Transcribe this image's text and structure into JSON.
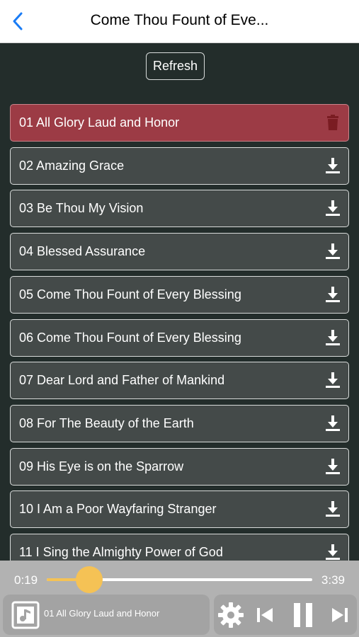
{
  "nav": {
    "title": "Come Thou Fount of Eve...",
    "back_icon": "chevron-left-icon",
    "accent_color": "#1a7cf5"
  },
  "toolbar": {
    "refresh_label": "Refresh"
  },
  "tracks": [
    {
      "label": "01  All Glory Laud and Honor",
      "icon": "trash-icon",
      "active": true
    },
    {
      "label": "02  Amazing Grace",
      "icon": "download-icon",
      "active": false
    },
    {
      "label": "03  Be Thou My Vision",
      "icon": "download-icon",
      "active": false
    },
    {
      "label": "04  Blessed Assurance",
      "icon": "download-icon",
      "active": false
    },
    {
      "label": "05  Come Thou Fount of Every Blessing",
      "icon": "download-icon",
      "active": false
    },
    {
      "label": "06  Come Thou Fount of Every Blessing",
      "icon": "download-icon",
      "active": false
    },
    {
      "label": "07  Dear Lord and Father of Mankind",
      "icon": "download-icon",
      "active": false
    },
    {
      "label": "08  For The Beauty of the Earth",
      "icon": "download-icon",
      "active": false
    },
    {
      "label": "09  His Eye is on the Sparrow",
      "icon": "download-icon",
      "active": false
    },
    {
      "label": "10  I Am a Poor Wayfaring Stranger",
      "icon": "download-icon",
      "active": false
    },
    {
      "label": "11  I Sing the Almighty Power of God",
      "icon": "download-icon",
      "active": false
    }
  ],
  "player": {
    "current_time": "0:19",
    "total_time": "3:39",
    "progress": 0.16,
    "now_playing": "01  All Glory Laud and Honor",
    "progress_color": "#f5c255",
    "controls": [
      "gear-icon",
      "previous-icon",
      "pause-icon",
      "next-icon"
    ]
  }
}
